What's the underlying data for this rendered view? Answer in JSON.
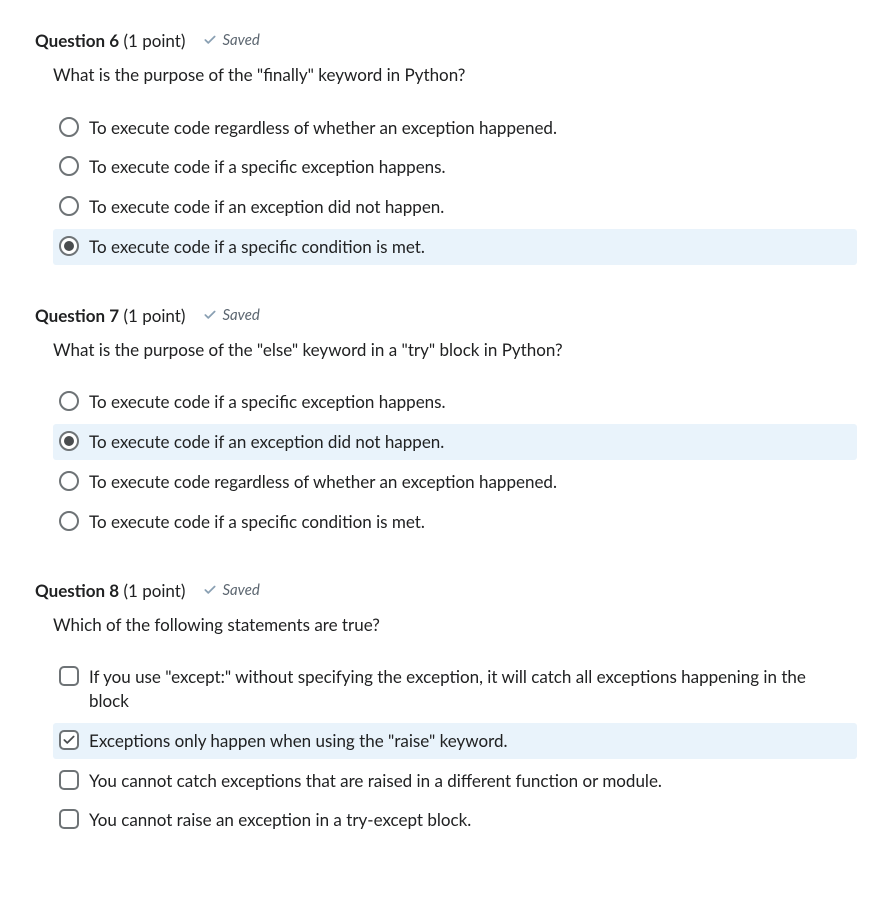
{
  "saved_label": "Saved",
  "questions": [
    {
      "number": "6",
      "title_prefix": "Question ",
      "points": "(1 point)",
      "saved": true,
      "prompt": "What is the purpose of the \"finally\" keyword in Python?",
      "type": "radio",
      "options": [
        {
          "text": "To execute code regardless of whether an exception happened.",
          "checked": false
        },
        {
          "text": "To execute code if a specific exception happens.",
          "checked": false
        },
        {
          "text": "To execute code if an exception did not happen.",
          "checked": false
        },
        {
          "text": "To execute code if a specific condition is met.",
          "checked": true
        }
      ]
    },
    {
      "number": "7",
      "title_prefix": "Question ",
      "points": "(1 point)",
      "saved": true,
      "prompt": "What is the purpose of the \"else\" keyword in a \"try\" block in Python?",
      "type": "radio",
      "options": [
        {
          "text": "To execute code if a specific exception happens.",
          "checked": false
        },
        {
          "text": "To execute code if an exception did not happen.",
          "checked": true
        },
        {
          "text": "To execute code regardless of whether an exception happened.",
          "checked": false
        },
        {
          "text": "To execute code if a specific condition is met.",
          "checked": false
        }
      ]
    },
    {
      "number": "8",
      "title_prefix": "Question ",
      "points": "(1 point)",
      "saved": true,
      "prompt": "Which of the following statements are true?",
      "type": "checkbox",
      "options": [
        {
          "text": "If you use \"except:\" without specifying the exception, it will catch all exceptions happening in the block",
          "checked": false
        },
        {
          "text": "Exceptions only happen when using the \"raise\" keyword.",
          "checked": true
        },
        {
          "text": "You cannot catch exceptions that are raised in a different function or module.",
          "checked": false
        },
        {
          "text": "You cannot raise an exception in a try-except block.",
          "checked": false
        }
      ]
    }
  ]
}
